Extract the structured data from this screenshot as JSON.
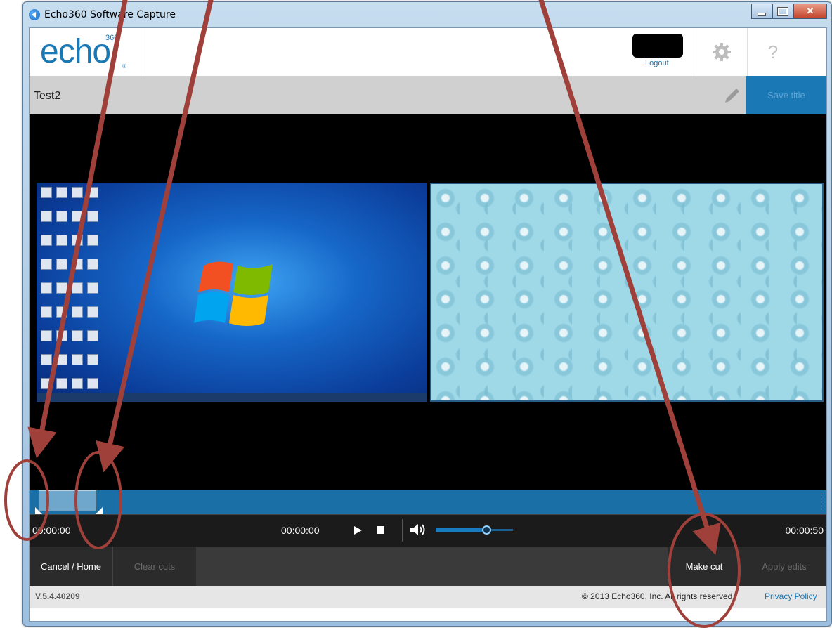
{
  "window": {
    "title": "Echo360 Software Capture",
    "frame_color": "#9dbfdf"
  },
  "header": {
    "logo_text": "echo",
    "logo_superscript": "360",
    "logout_label": "Logout",
    "settings_icon": "gear-icon",
    "help_label": "?"
  },
  "recording": {
    "title": "Test2",
    "save_title_label": "Save title",
    "edit_icon": "pencil-icon"
  },
  "player": {
    "start_time": "00:00:00",
    "current_time": "00:00:00",
    "end_time": "00:00:50",
    "volume_fraction": 0.6
  },
  "actions": {
    "cancel_home": "Cancel / Home",
    "clear_cuts": "Clear cuts",
    "make_cut": "Make cut",
    "apply_edits": "Apply edits"
  },
  "footer": {
    "version": "V.5.4.40209",
    "copyright": "© 2013 Echo360, Inc. All rights reserved.",
    "privacy_policy": "Privacy Policy"
  },
  "colors": {
    "accent": "#1a78b4",
    "annotation": "#a0403a"
  }
}
